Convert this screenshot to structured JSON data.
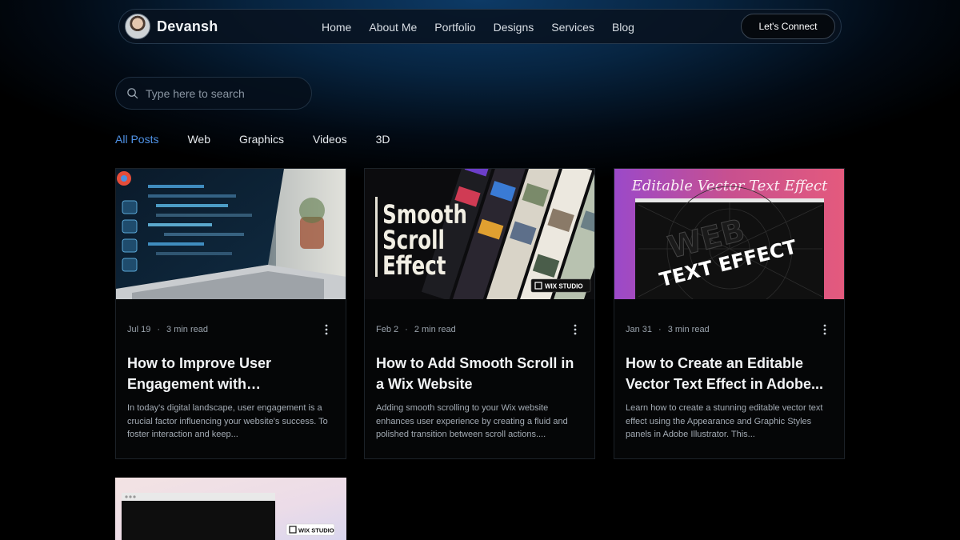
{
  "nav": {
    "brand": "Devansh",
    "links": [
      "Home",
      "About Me",
      "Portfolio",
      "Designs",
      "Services",
      "Blog"
    ],
    "cta": "Let's Connect"
  },
  "search": {
    "placeholder": "Type here to search"
  },
  "filters": {
    "items": [
      "All Posts",
      "Web",
      "Graphics",
      "Videos",
      "3D"
    ],
    "active": "All Posts"
  },
  "colors": {
    "accent": "#4f92e6",
    "background": "#000000"
  },
  "posts": [
    {
      "date": "Jul 19",
      "read_time": "3 min read",
      "title": "How to Improve User Engagement with Responsive...",
      "excerpt": "In today's digital landscape, user engagement is a crucial factor influencing your website's success. To foster interaction and keep..."
    },
    {
      "date": "Feb 2",
      "read_time": "2 min read",
      "title": "How to Add Smooth Scroll in a Wix Website",
      "excerpt": "Adding smooth scrolling to your Wix website enhances user experience by creating a fluid and polished transition between scroll actions....",
      "thumb_text": [
        "Smooth",
        "Scroll",
        "Effect"
      ],
      "badge": "WIX STUDIO"
    },
    {
      "date": "Jan 31",
      "read_time": "3 min read",
      "title": "How to Create an Editable Vector Text Effect in Adobe...",
      "excerpt": "Learn how to create a stunning editable vector text effect using the Appearance and Graphic Styles panels in Adobe Illustrator. This...",
      "thumb_heading": "Editable Vector Text Effect",
      "thumb_text": [
        "WEB",
        "TEXT EFFECT"
      ]
    },
    {
      "badge": "WIX STUDIO"
    }
  ]
}
